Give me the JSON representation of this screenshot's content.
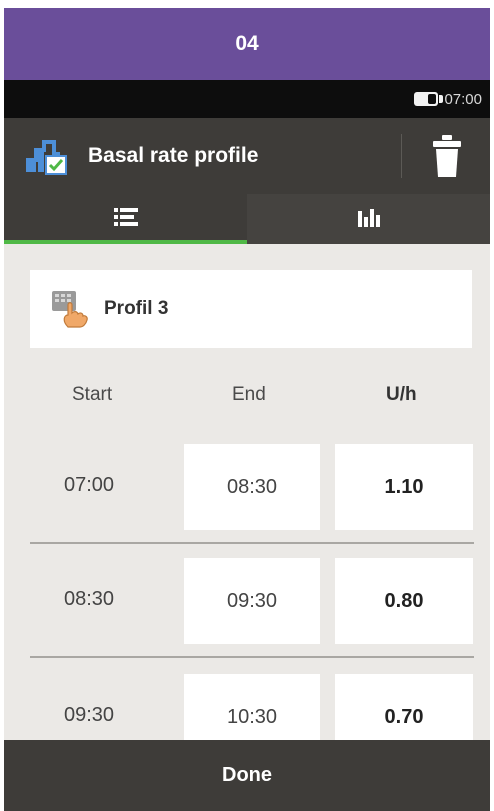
{
  "step": {
    "number": "04",
    "color": "#6a4e9a"
  },
  "status": {
    "battery_icon": "battery-icon",
    "time": "07:00"
  },
  "header": {
    "title": "Basal rate profile",
    "icon": "basal-profile-icon",
    "delete_icon": "trash-icon"
  },
  "tabs": [
    {
      "id": "list",
      "icon": "list-icon",
      "active": true
    },
    {
      "id": "chart",
      "icon": "bar-chart-icon",
      "active": false
    }
  ],
  "profile": {
    "name": "Profil 3",
    "icon": "hand-select-icon"
  },
  "table": {
    "headers": {
      "start": "Start",
      "end": "End",
      "rate": "U/h"
    },
    "rows": [
      {
        "start": "07:00",
        "end": "08:30",
        "rate": "1.10"
      },
      {
        "start": "08:30",
        "end": "09:30",
        "rate": "0.80"
      },
      {
        "start": "09:30",
        "end": "10:30",
        "rate": "0.70"
      }
    ]
  },
  "footer": {
    "done_label": "Done"
  },
  "colors": {
    "accent": "#4fb846",
    "dark_bar": "#3e3c39",
    "background": "#ebe9e6"
  }
}
